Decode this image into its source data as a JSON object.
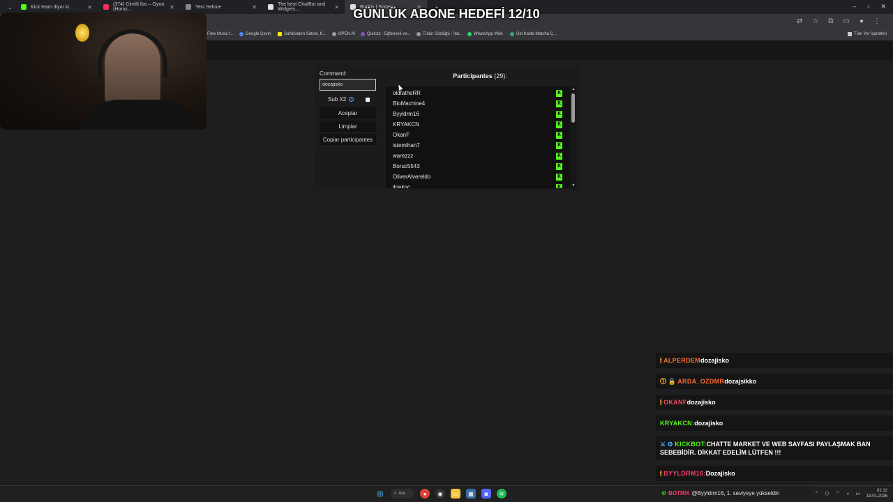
{
  "browser": {
    "tabs": [
      {
        "title": "Kick team diyor ki...",
        "color": "#53fc18"
      },
      {
        "title": "(374) Cimilli İbo – Oyna (Horoz...",
        "color": "#ff2d55"
      },
      {
        "title": "Yeni Sekme",
        "color": "#9aa0a6"
      },
      {
        "title": "The best ChatBot and Widgets...",
        "color": "#e0e0e0"
      },
      {
        "title": "BotRix | Sorteos",
        "color": "#e0e0e0"
      }
    ],
    "bookmarks": [
      "Free Music f...",
      "Google Çeviri",
      "Sahibinden Satılık, K...",
      "OPEN AI",
      "Quizizz - Eğlenceli ve...",
      "Tütün Sözlüğü - İtal...",
      "WhatsApp Web",
      "Üst Kalite Matcha Ç...",
      "Tüm Yer İşaretleri"
    ]
  },
  "overlay": {
    "goal": "GÜNLÜK ABONE HEDEFİ 12/10"
  },
  "command": {
    "label": "Command:",
    "value": "dozajisko",
    "sub_label": "Sub X2",
    "accept": "Aceptar",
    "clear": "Limpiar",
    "copy": "Copiar participantes"
  },
  "participants": {
    "title": "Participantes",
    "count": "(29)",
    "suffix": ":",
    "names": [
      "oldfatheRR",
      "BioMachine4",
      "Byyldrm16",
      "KRYAKCN",
      "OkanF",
      "istemihan7",
      "warezzz",
      "Boruc5543",
      "OliverAlvereldo",
      "ilpekoc"
    ],
    "platform_icon": "kick-icon"
  },
  "chat": [
    {
      "badge": "🕯",
      "name": "ALPERDEM",
      "name_color": "#ff6a2a",
      "text": "dozajisko"
    },
    {
      "badge": "⓵ 🔒",
      "name": "ARDA_OZDMR",
      "name_color": "#ff6a2a",
      "text": "dozajsikko"
    },
    {
      "badge": "🕯",
      "name": "OKANF",
      "name_color": "#ff4a5a",
      "text": "dozajisko"
    },
    {
      "badge": "",
      "name": "KRYAKCN:",
      "name_color": "#53fc18",
      "text": "dozajisko"
    },
    {
      "badge": "⚔ ⚙",
      "name": "KICKBOT:",
      "name_color": "#53fc18",
      "text": "CHATTE MARKET VE WEB SAYFASI PAYLAŞMAK BAN SEBEBİDİR. DİKKAT EDELİM LÜTFEN !!!"
    },
    {
      "badge": "🕯",
      "name": "BYYLDRM16:",
      "name_color": "#ff3a6e",
      "text": "Dozajisko"
    }
  ],
  "notification": {
    "name": "BOTRIX",
    "text": "@Byyldrm16, 1. seviyeye yükseldin"
  },
  "taskbar": {
    "search": "Ara",
    "time": "01:12",
    "date": "19.01.2026"
  }
}
